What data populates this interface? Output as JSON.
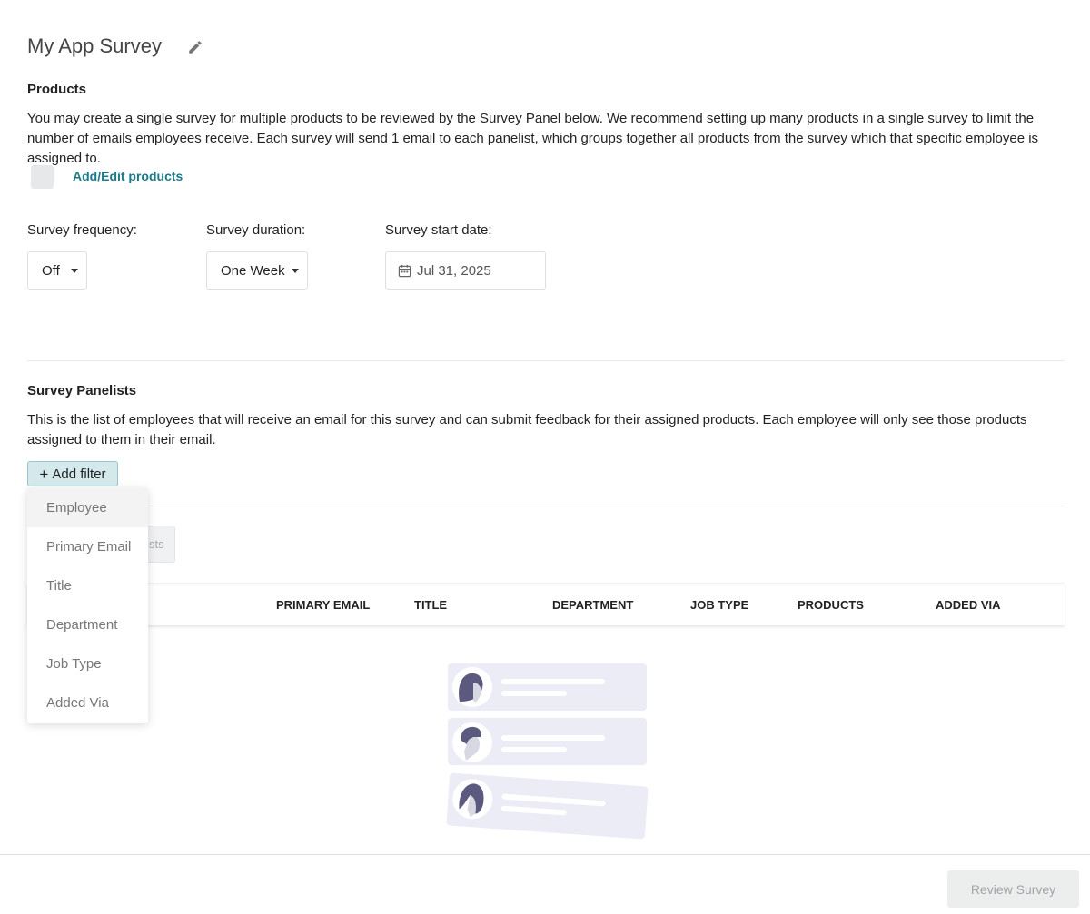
{
  "page": {
    "title": "My App Survey"
  },
  "products": {
    "heading": "Products",
    "description": "You may create a single survey for multiple products to be reviewed by the Survey Panel below. We recommend setting up many products in a single survey to limit the number of emails employees receive. Each survey will send 1 email to each panelist, which groups together all products from the survey which that specific employee is assigned to.",
    "add_edit_link": "Add/Edit products"
  },
  "settings": {
    "frequency": {
      "label": "Survey frequency:",
      "value": "Off"
    },
    "duration": {
      "label": "Survey duration:",
      "value": "One Week"
    },
    "start_date": {
      "label": "Survey start date:",
      "value": "Jul 31, 2025"
    }
  },
  "panelists": {
    "heading": "Survey Panelists",
    "description": "This is the list of employees that will receive an email for this survey and can submit feedback for their assigned products. Each employee will only see those products assigned to them in their email.",
    "add_filter_label": "Add filter",
    "ghost_button_partial": "sts",
    "filter_options": [
      "Employee",
      "Primary Email",
      "Title",
      "Department",
      "Job Type",
      "Added Via"
    ],
    "columns": [
      "PRIMARY EMAIL",
      "TITLE",
      "DEPARTMENT",
      "JOB TYPE",
      "PRODUCTS",
      "ADDED VIA"
    ]
  },
  "footer": {
    "review_button": "Review Survey"
  },
  "colors": {
    "link": "#1a7a86",
    "filter_bg": "#d3e9ec",
    "illustration_accent": "#5b5a7e"
  }
}
